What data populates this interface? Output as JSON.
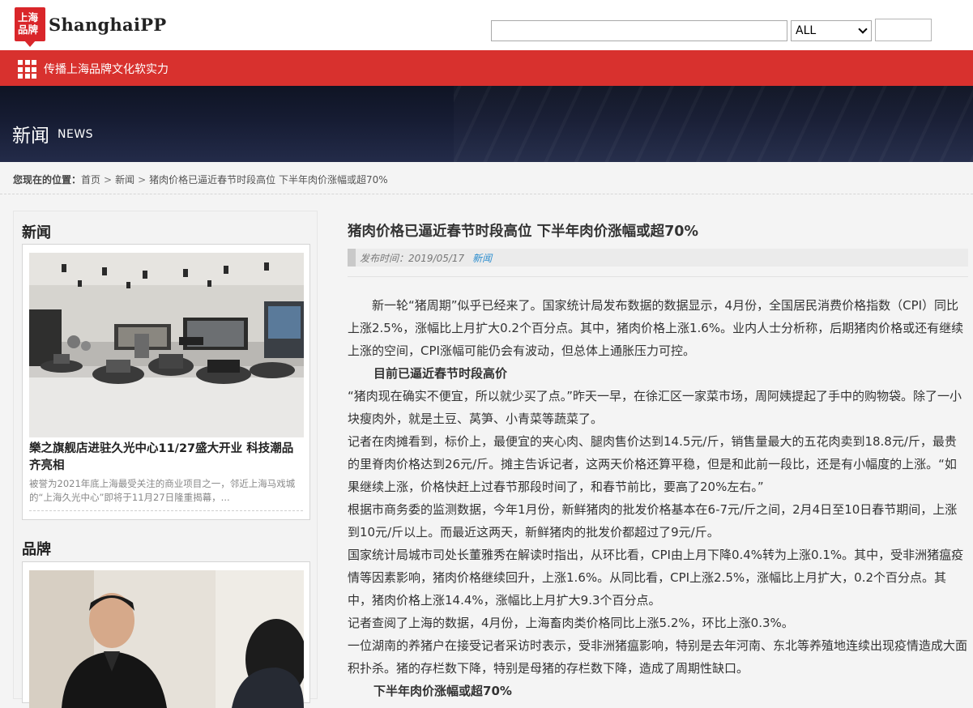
{
  "header": {
    "logo_mark": "上海品牌",
    "logo_text": "ShanghaiPP",
    "search": {
      "placeholder": "",
      "scope": "ALL",
      "button_label": ""
    }
  },
  "nav": {
    "slogan": "传播上海品牌文化软实力"
  },
  "banner": {
    "title": "新闻",
    "subtitle": "NEWS"
  },
  "breadcrumb": {
    "prefix": "您现在的位置：",
    "items": [
      "首页",
      "新闻",
      "猪肉价格已逼近春节时段高位 下半年肉价涨幅或超70%"
    ],
    "separator": ">"
  },
  "sidebar": {
    "sections": [
      {
        "heading": "新闻",
        "card": {
          "title": "樂之旗舰店进驻久光中心11/27盛大开业 科技潮品齐亮相",
          "desc": "被誉为2021年底上海最受关注的商业项目之一，邻近上海马戏城的“上海久光中心”即将于11月27日隆重揭幕，..."
        }
      },
      {
        "heading": "品牌"
      }
    ]
  },
  "article": {
    "title": "猪肉价格已逼近春节时段高位 下半年肉价涨幅或超70%",
    "date": "发布时间：2019/05/17",
    "category": "新闻",
    "paragraphs": [
      {
        "type": "ind",
        "text": "新一轮“猪周期”似乎已经来了。国家统计局发布数据的数据显示，4月份，全国居民消费价格指数（CPI）同比上涨2.5%，涨幅比上月扩大0.2个百分点。其中，猪肉价格上涨1.6%。业内人士分析称，后期猪肉价格或还有继续上涨的空间，CPI涨幅可能仍会有波动，但总体上通胀压力可控。"
      },
      {
        "type": "h",
        "text": "目前已逼近春节时段高价"
      },
      {
        "type": "p",
        "text": "“猪肉现在确实不便宜，所以就少买了点。”昨天一早，在徐汇区一家菜市场，周阿姨提起了手中的购物袋。除了一小块瘦肉外，就是土豆、莴笋、小青菜等蔬菜了。"
      },
      {
        "type": "p",
        "text": "记者在肉摊看到，标价上，最便宜的夹心肉、腿肉售价达到14.5元/斤，销售量最大的五花肉卖到18.8元/斤，最贵的里脊肉价格达到26元/斤。摊主告诉记者，这两天价格还算平稳，但是和此前一段比，还是有小幅度的上涨。“如果继续上涨，价格快赶上过春节那段时间了，和春节前比，要高了20%左右。”"
      },
      {
        "type": "p",
        "text": "根据市商务委的监测数据，今年1月份，新鲜猪肉的批发价格基本在6-7元/斤之间，2月4日至10日春节期间，上涨到10元/斤以上。而最近这两天，新鲜猪肉的批发价都超过了9元/斤。"
      },
      {
        "type": "p",
        "text": "国家统计局城市司处长董雅秀在解读时指出，从环比看，CPI由上月下降0.4%转为上涨0.1%。其中，受非洲猪瘟疫情等因素影响，猪肉价格继续回升，上涨1.6%。从同比看，CPI上涨2.5%，涨幅比上月扩大，0.2个百分点。其中，猪肉价格上涨14.4%，涨幅比上月扩大9.3个百分点。"
      },
      {
        "type": "p",
        "text": "记者查阅了上海的数据，4月份，上海畜肉类价格同比上涨5.2%，环比上涨0.3%。"
      },
      {
        "type": "p",
        "text": "一位湖南的养猪户在接受记者采访时表示，受非洲猪瘟影响，特别是去年河南、东北等养殖地连续出现疫情造成大面积扑杀。猪的存栏数下降，特别是母猪的存栏数下降，造成了周期性缺口。"
      },
      {
        "type": "h2",
        "text": "下半年肉价涨幅或超70%"
      }
    ]
  }
}
